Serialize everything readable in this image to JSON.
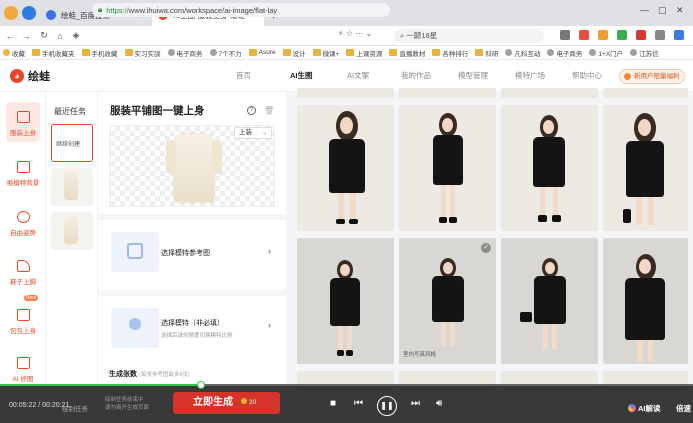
{
  "browser": {
    "tabs": [
      {
        "label": "绘蛙_百度搜索"
      },
      {
        "label": "AI生图-服装上身-绘蛙"
      }
    ],
    "new_tab": "+",
    "url_protocol": "https://",
    "url_rest": "www.ihuiwa.com/workspace/ai-image/flat-lay",
    "search_text": "一颠18星",
    "bookmarks": [
      "收藏",
      "手机收藏夹",
      "手机收藏",
      "实习实訓",
      "电子商务",
      "7个不力",
      "Asure",
      "设计",
      "微课+",
      "上课资源",
      "直播教材",
      "各种排行",
      "科研",
      "凡科互动",
      "电子商务",
      "1+X门户",
      "江苏信"
    ]
  },
  "app": {
    "logo_text": "绘蛙",
    "nav": [
      "首页",
      "AI生图",
      "AI文案",
      "我的作品",
      "模型管理",
      "模特广场",
      "帮助中心"
    ],
    "promo": "新用户限量福利",
    "accent": "#e8452a"
  },
  "rail": {
    "items": [
      {
        "label": "服装上身",
        "icon": "shirt-icon"
      },
      {
        "label": "换模特背景",
        "icon": "model-swap-icon"
      },
      {
        "label": "自由姿势",
        "icon": "pose-icon"
      },
      {
        "label": "鞋子上脚",
        "icon": "shoe-icon"
      },
      {
        "label": "包包上身",
        "icon": "bag-icon"
      },
      {
        "label": "AI 修图",
        "icon": "retouch-icon"
      }
    ],
    "badge": "New"
  },
  "recent": {
    "title": "最近任务",
    "first_item": "继续创建"
  },
  "editor": {
    "title": "服装平铺图一键上身",
    "garment_type": "上装",
    "ref_model_title": "选择模特参考图",
    "model_title": "选择模特（非必填）",
    "model_sub": "选择后请勿随意切换模特比例",
    "gen_count_label": "生成张数",
    "gen_count_hint": "(每张参考图最多8张)"
  },
  "gallery": {
    "captions": [
      "室内写真风格"
    ]
  },
  "player": {
    "time": "00:05:22 / 00:20:21",
    "under_task": "绘制任务",
    "under_hint_1": "绘制任务结束中",
    "under_hint_2": "请勿离开生成页面",
    "generate_label": "立即生成",
    "cost": "20",
    "progress_fraction": 0.29,
    "ai_label": "AI解读",
    "speed_label": "倍速"
  }
}
